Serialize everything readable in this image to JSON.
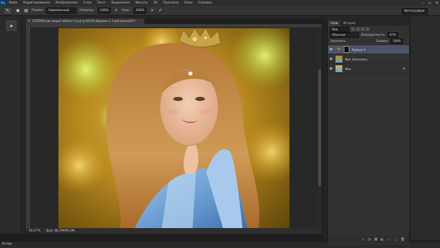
{
  "menu": {
    "logo": "Ps",
    "items": [
      "Файл",
      "Редактирование",
      "Изображение",
      "Слои",
      "Текст",
      "Выделение",
      "Фильтр",
      "3D",
      "Просмотр",
      "Окно",
      "Справка"
    ]
  },
  "options": {
    "mode_label": "Режим:",
    "mode_value": "Нормальный",
    "opacity_label": "Непрозр.:",
    "opacity_value": "100%",
    "flow_label": "Наж.:",
    "flow_value": "100%",
    "workspace": "Фотография"
  },
  "document": {
    "tab_title": "2555959-как-сверит-объект-1.psd @ 66,6% (Кривые 1, Слой-маска/16) *",
    "zoom": "66,67%",
    "info": "Док: 46,7М/99,5М"
  },
  "layers_panel": {
    "tabs": [
      "Слои",
      "История"
    ],
    "filter_label": "Вид",
    "blend_mode": "Обычные",
    "opacity_label": "Непрозрачность:",
    "opacity_value": "67%",
    "lock_label": "Закрепить:",
    "fill_label": "Заливка:",
    "fill_value": "100%",
    "layers": [
      {
        "name": "Кривые 1",
        "visible": true,
        "selected": true,
        "locked": false
      },
      {
        "name": "Фон Заполнить",
        "visible": true,
        "selected": false,
        "locked": false
      },
      {
        "name": "Фон",
        "visible": true,
        "selected": false,
        "locked": true
      }
    ]
  },
  "bottom": {
    "bridge_label": "Bridge"
  },
  "colors": {
    "accent_selected_layer": "#4a556a",
    "ui_dark": "#262626"
  }
}
